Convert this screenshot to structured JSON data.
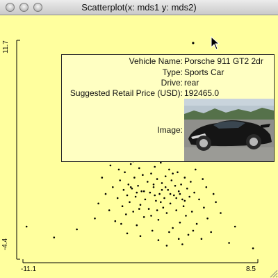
{
  "window": {
    "title": "Scatterplot(x: mds1 y: mds2)"
  },
  "axes": {
    "y_max_label": "11.7",
    "y_min_label": "-4.4",
    "x_min_label": "-11.1",
    "x_max_label": "8.5"
  },
  "tooltip": {
    "rows": [
      {
        "label": "Vehicle Name:",
        "value": "Porsche 911 GT2 2dr"
      },
      {
        "label": "Type:",
        "value": "Sports Car"
      },
      {
        "label": "Drive:",
        "value": "rear"
      },
      {
        "label": "Suggested Retail Price (USD):",
        "value": "192465.0"
      }
    ],
    "image_label": "Image:"
  },
  "colors": {
    "plot_background": "#ffff9e",
    "tooltip_background": "#ffffc2",
    "point_color": "#000000"
  },
  "chart_data": {
    "type": "scatter",
    "xlim": [
      -11.1,
      8.5
    ],
    "ylim": [
      -4.4,
      11.7
    ],
    "xlabel": "",
    "ylabel": "",
    "grid": false,
    "highlighted_point": {
      "x": 3.1,
      "y": 11.5
    },
    "points": [
      [
        -10.8,
        -2.0
      ],
      [
        -8.5,
        -2.8
      ],
      [
        -6.6,
        -2.2
      ],
      [
        -5.1,
        -1.4
      ],
      [
        -4.8,
        -0.3
      ],
      [
        -4.2,
        0.4
      ],
      [
        -3.9,
        -0.8
      ],
      [
        -3.6,
        0.9
      ],
      [
        -3.4,
        -1.6
      ],
      [
        -3.2,
        0.1
      ],
      [
        -3.0,
        1.4
      ],
      [
        -2.8,
        -0.5
      ],
      [
        -2.7,
        0.7
      ],
      [
        -2.6,
        2.0
      ],
      [
        -2.5,
        -1.1
      ],
      [
        -2.4,
        0.3
      ],
      [
        -2.3,
        1.1
      ],
      [
        -2.2,
        -0.2
      ],
      [
        -2.1,
        2.6
      ],
      [
        -2.0,
        0.8
      ],
      [
        -1.9,
        -0.9
      ],
      [
        -1.8,
        1.6
      ],
      [
        -1.7,
        0.2
      ],
      [
        -1.6,
        -1.9
      ],
      [
        -1.5,
        1.0
      ],
      [
        -1.4,
        2.3
      ],
      [
        -1.3,
        -0.4
      ],
      [
        -1.2,
        0.6
      ],
      [
        -1.1,
        1.8
      ],
      [
        -1.0,
        -1.3
      ],
      [
        -0.9,
        0.0
      ],
      [
        -0.8,
        2.9
      ],
      [
        -0.7,
        1.3
      ],
      [
        -0.6,
        -0.7
      ],
      [
        -0.5,
        0.5
      ],
      [
        -0.4,
        1.9
      ],
      [
        -0.3,
        -2.3
      ],
      [
        -0.2,
        0.9
      ],
      [
        -0.1,
        2.4
      ],
      [
        0.0,
        -0.1
      ],
      [
        0.1,
        1.5
      ],
      [
        0.2,
        -1.5
      ],
      [
        0.3,
        0.4
      ],
      [
        0.4,
        2.7
      ],
      [
        0.5,
        1.2
      ],
      [
        0.6,
        -0.6
      ],
      [
        0.7,
        0.1
      ],
      [
        0.8,
        1.7
      ],
      [
        0.9,
        -1.0
      ],
      [
        1.0,
        0.7
      ],
      [
        1.1,
        2.2
      ],
      [
        1.2,
        -0.3
      ],
      [
        1.3,
        1.4
      ],
      [
        1.4,
        -2.1
      ],
      [
        1.5,
        0.3
      ],
      [
        1.6,
        1.0
      ],
      [
        1.7,
        -0.8
      ],
      [
        1.8,
        2.0
      ],
      [
        1.9,
        0.6
      ],
      [
        2.0,
        -1.7
      ],
      [
        2.1,
        1.1
      ],
      [
        2.2,
        0.0
      ],
      [
        2.3,
        -0.5
      ],
      [
        2.4,
        1.6
      ],
      [
        2.5,
        -1.2
      ],
      [
        2.6,
        0.8
      ],
      [
        2.7,
        -2.6
      ],
      [
        2.8,
        0.2
      ],
      [
        2.9,
        1.3
      ],
      [
        3.0,
        -0.9
      ],
      [
        3.2,
        0.5
      ],
      [
        3.4,
        -1.8
      ],
      [
        3.6,
        0.0
      ],
      [
        3.8,
        -2.9
      ],
      [
        4.0,
        -0.6
      ],
      [
        4.3,
        -1.4
      ],
      [
        4.6,
        -2.4
      ],
      [
        5.0,
        -0.2
      ],
      [
        5.4,
        -1.0
      ],
      [
        6.1,
        -3.2
      ],
      [
        6.6,
        -2.0
      ],
      [
        8.1,
        -3.6
      ],
      [
        -2.9,
        -1.8
      ],
      [
        -1.9,
        2.8
      ],
      [
        -0.6,
        3.0
      ],
      [
        0.6,
        3.0
      ],
      [
        1.6,
        2.9
      ],
      [
        2.6,
        3.1
      ],
      [
        -3.1,
        2.2
      ],
      [
        -2.4,
        -2.5
      ],
      [
        -1.3,
        -2.7
      ],
      [
        0.2,
        -3.0
      ],
      [
        1.1,
        -2.4
      ],
      [
        2.2,
        -3.3
      ],
      [
        3.3,
        2.2
      ],
      [
        4.2,
        0.9
      ],
      [
        -4.5,
        1.6
      ],
      [
        -3.8,
        2.5
      ],
      [
        -0.9,
        3.1
      ],
      [
        0.9,
        -3.4
      ],
      [
        1.9,
        -2.9
      ],
      [
        3.1,
        -2.3
      ],
      [
        3.9,
        1.5
      ],
      [
        4.8,
        0.4
      ],
      [
        -1.6,
        0.5
      ],
      [
        -0.4,
        -1.2
      ],
      [
        0.8,
        0.9
      ],
      [
        1.4,
        1.9
      ],
      [
        -0.1,
        0.3
      ],
      [
        0.4,
        -0.2
      ],
      [
        1.2,
        0.4
      ],
      [
        2.0,
        0.4
      ],
      [
        -1.0,
        0.6
      ],
      [
        -0.2,
        1.1
      ],
      [
        0.5,
        0.7
      ],
      [
        1.7,
        0.1
      ],
      [
        -2.1,
        0.9
      ],
      [
        -1.4,
        -0.7
      ],
      [
        0.1,
        -0.8
      ],
      [
        2.4,
        -0.1
      ]
    ]
  }
}
